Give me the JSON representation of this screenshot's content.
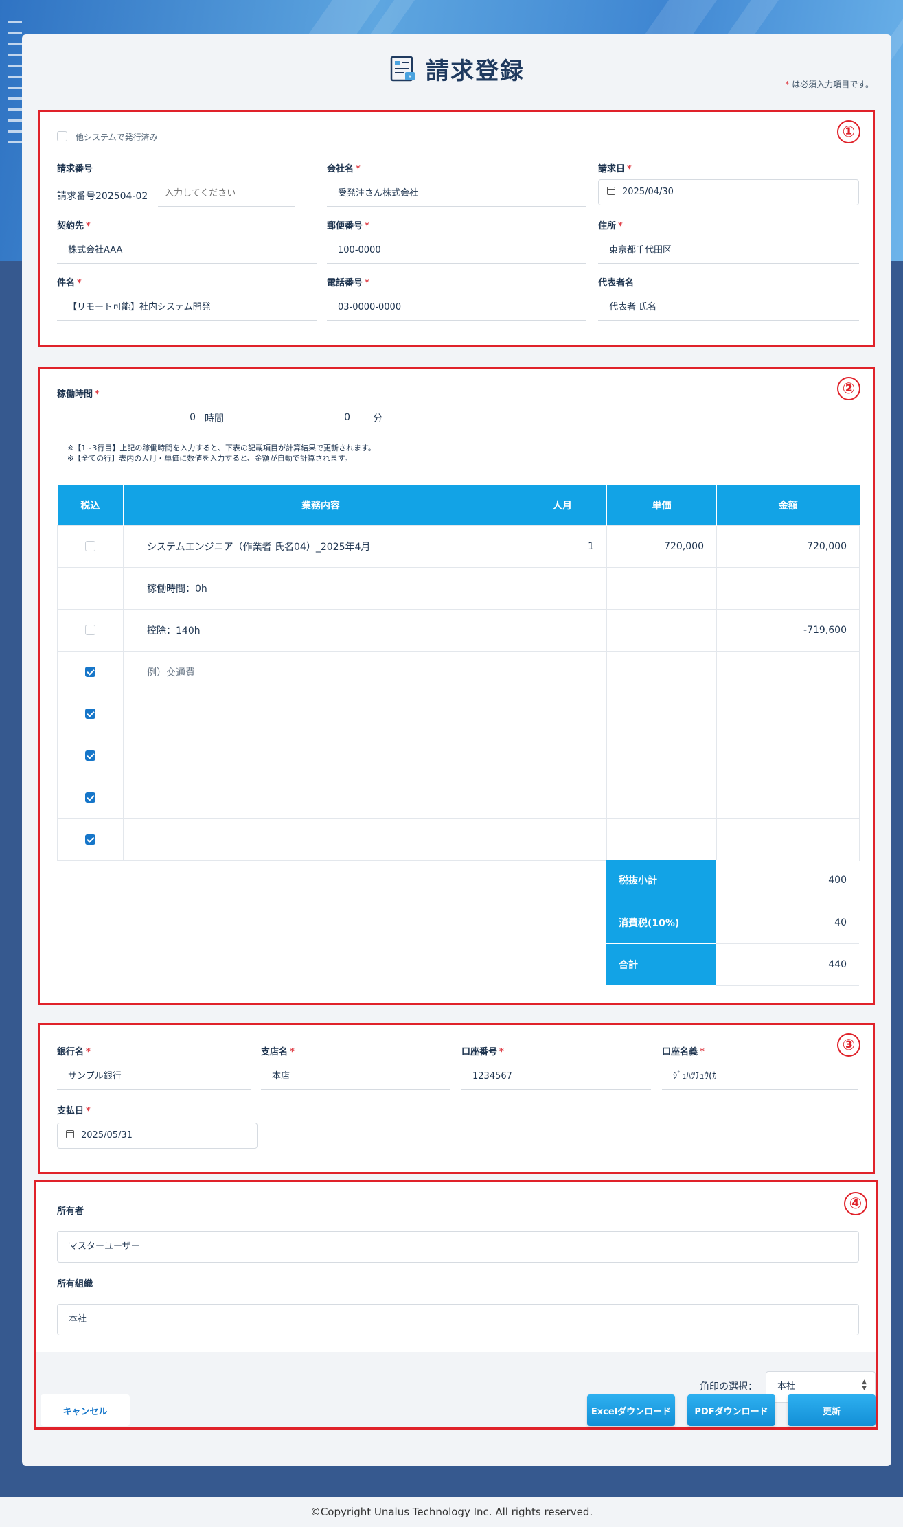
{
  "header": {
    "title": "請求登録",
    "required_note": "は必須入力項目です。",
    "required_mark": "*"
  },
  "section_numbers": [
    "①",
    "②",
    "③",
    "④"
  ],
  "section1": {
    "issued_other_system": "他システムで発行済み",
    "invoice_number": {
      "label": "請求番号",
      "prefix": "請求番号202504-02",
      "placeholder": "入力してください"
    },
    "company_name": {
      "label": "会社名",
      "value": "受発注さん株式会社"
    },
    "invoice_date": {
      "label": "請求日",
      "value": "2025/04/30"
    },
    "contractor": {
      "label": "契約先",
      "value": "株式会社AAA"
    },
    "postal_code": {
      "label": "郵便番号",
      "value": "100-0000"
    },
    "address": {
      "label": "住所",
      "value": "東京都千代田区"
    },
    "subject": {
      "label": "件名",
      "value": "【リモート可能】社内システム開発"
    },
    "phone": {
      "label": "電話番号",
      "value": "03-0000-0000"
    },
    "representative": {
      "label": "代表者名",
      "value": "代表者 氏名"
    }
  },
  "section2": {
    "work_time_label": "稼働時間",
    "hours_value": "0",
    "hours_unit": "時間",
    "minutes_value": "0",
    "minutes_unit": "分",
    "note1": "※【1~3行目】上記の稼働時間を入力すると、下表の記載項目が計算結果で更新されます。",
    "note2": "※【全ての行】表内の人月・単価に数値を入力すると、金額が自動で計算されます。",
    "columns": [
      "税込",
      "業務内容",
      "人月",
      "単価",
      "金額"
    ],
    "rows": [
      {
        "taxed": false,
        "show_cb": true,
        "content": "システムエンジニア（作業者 氏名04）_2025年4月",
        "months": "1",
        "unit_price": "720,000",
        "amount": "720,000"
      },
      {
        "taxed": false,
        "show_cb": false,
        "content": "稼働時間：0h",
        "months": "",
        "unit_price": "",
        "amount": ""
      },
      {
        "taxed": false,
        "show_cb": true,
        "content": "控除：140h",
        "months": "",
        "unit_price": "",
        "amount": "-719,600"
      },
      {
        "taxed": true,
        "show_cb": true,
        "content": "例）交通費",
        "months": "",
        "unit_price": "",
        "amount": "",
        "placeholder": true
      },
      {
        "taxed": true,
        "show_cb": true,
        "content": "",
        "months": "",
        "unit_price": "",
        "amount": ""
      },
      {
        "taxed": true,
        "show_cb": true,
        "content": "",
        "months": "",
        "unit_price": "",
        "amount": ""
      },
      {
        "taxed": true,
        "show_cb": true,
        "content": "",
        "months": "",
        "unit_price": "",
        "amount": ""
      },
      {
        "taxed": true,
        "show_cb": true,
        "content": "",
        "months": "",
        "unit_price": "",
        "amount": ""
      }
    ],
    "summary": [
      {
        "label": "税抜小計",
        "value": "400"
      },
      {
        "label": "消費税(10%)",
        "value": "40"
      },
      {
        "label": "合計",
        "value": "440"
      }
    ]
  },
  "section3": {
    "bank_name": {
      "label": "銀行名",
      "value": "サンプル銀行"
    },
    "branch_name": {
      "label": "支店名",
      "value": "本店"
    },
    "account_number": {
      "label": "口座番号",
      "value": "1234567"
    },
    "account_holder": {
      "label": "口座名義",
      "value": "ｼﾞｭﾊﾂﾁｭｳ(ｶ"
    },
    "payment_date": {
      "label": "支払日",
      "value": "2025/05/31"
    }
  },
  "section4": {
    "owner": {
      "label": "所有者",
      "value": "マスターユーザー"
    },
    "owner_org": {
      "label": "所有組織",
      "value": "本社"
    },
    "seal_label": "角印の選択：",
    "seal_value": "本社",
    "cancel": "キャンセル",
    "excel": "Excelダウンロード",
    "pdf": "PDFダウンロード",
    "update": "更新"
  },
  "footer": "©Copyright Unalus Technology Inc. All rights reserved.",
  "colors": {
    "accent": "#12a3e6",
    "frame": "#e0222a",
    "required": "#e0434b",
    "button": "#1a9be0"
  }
}
